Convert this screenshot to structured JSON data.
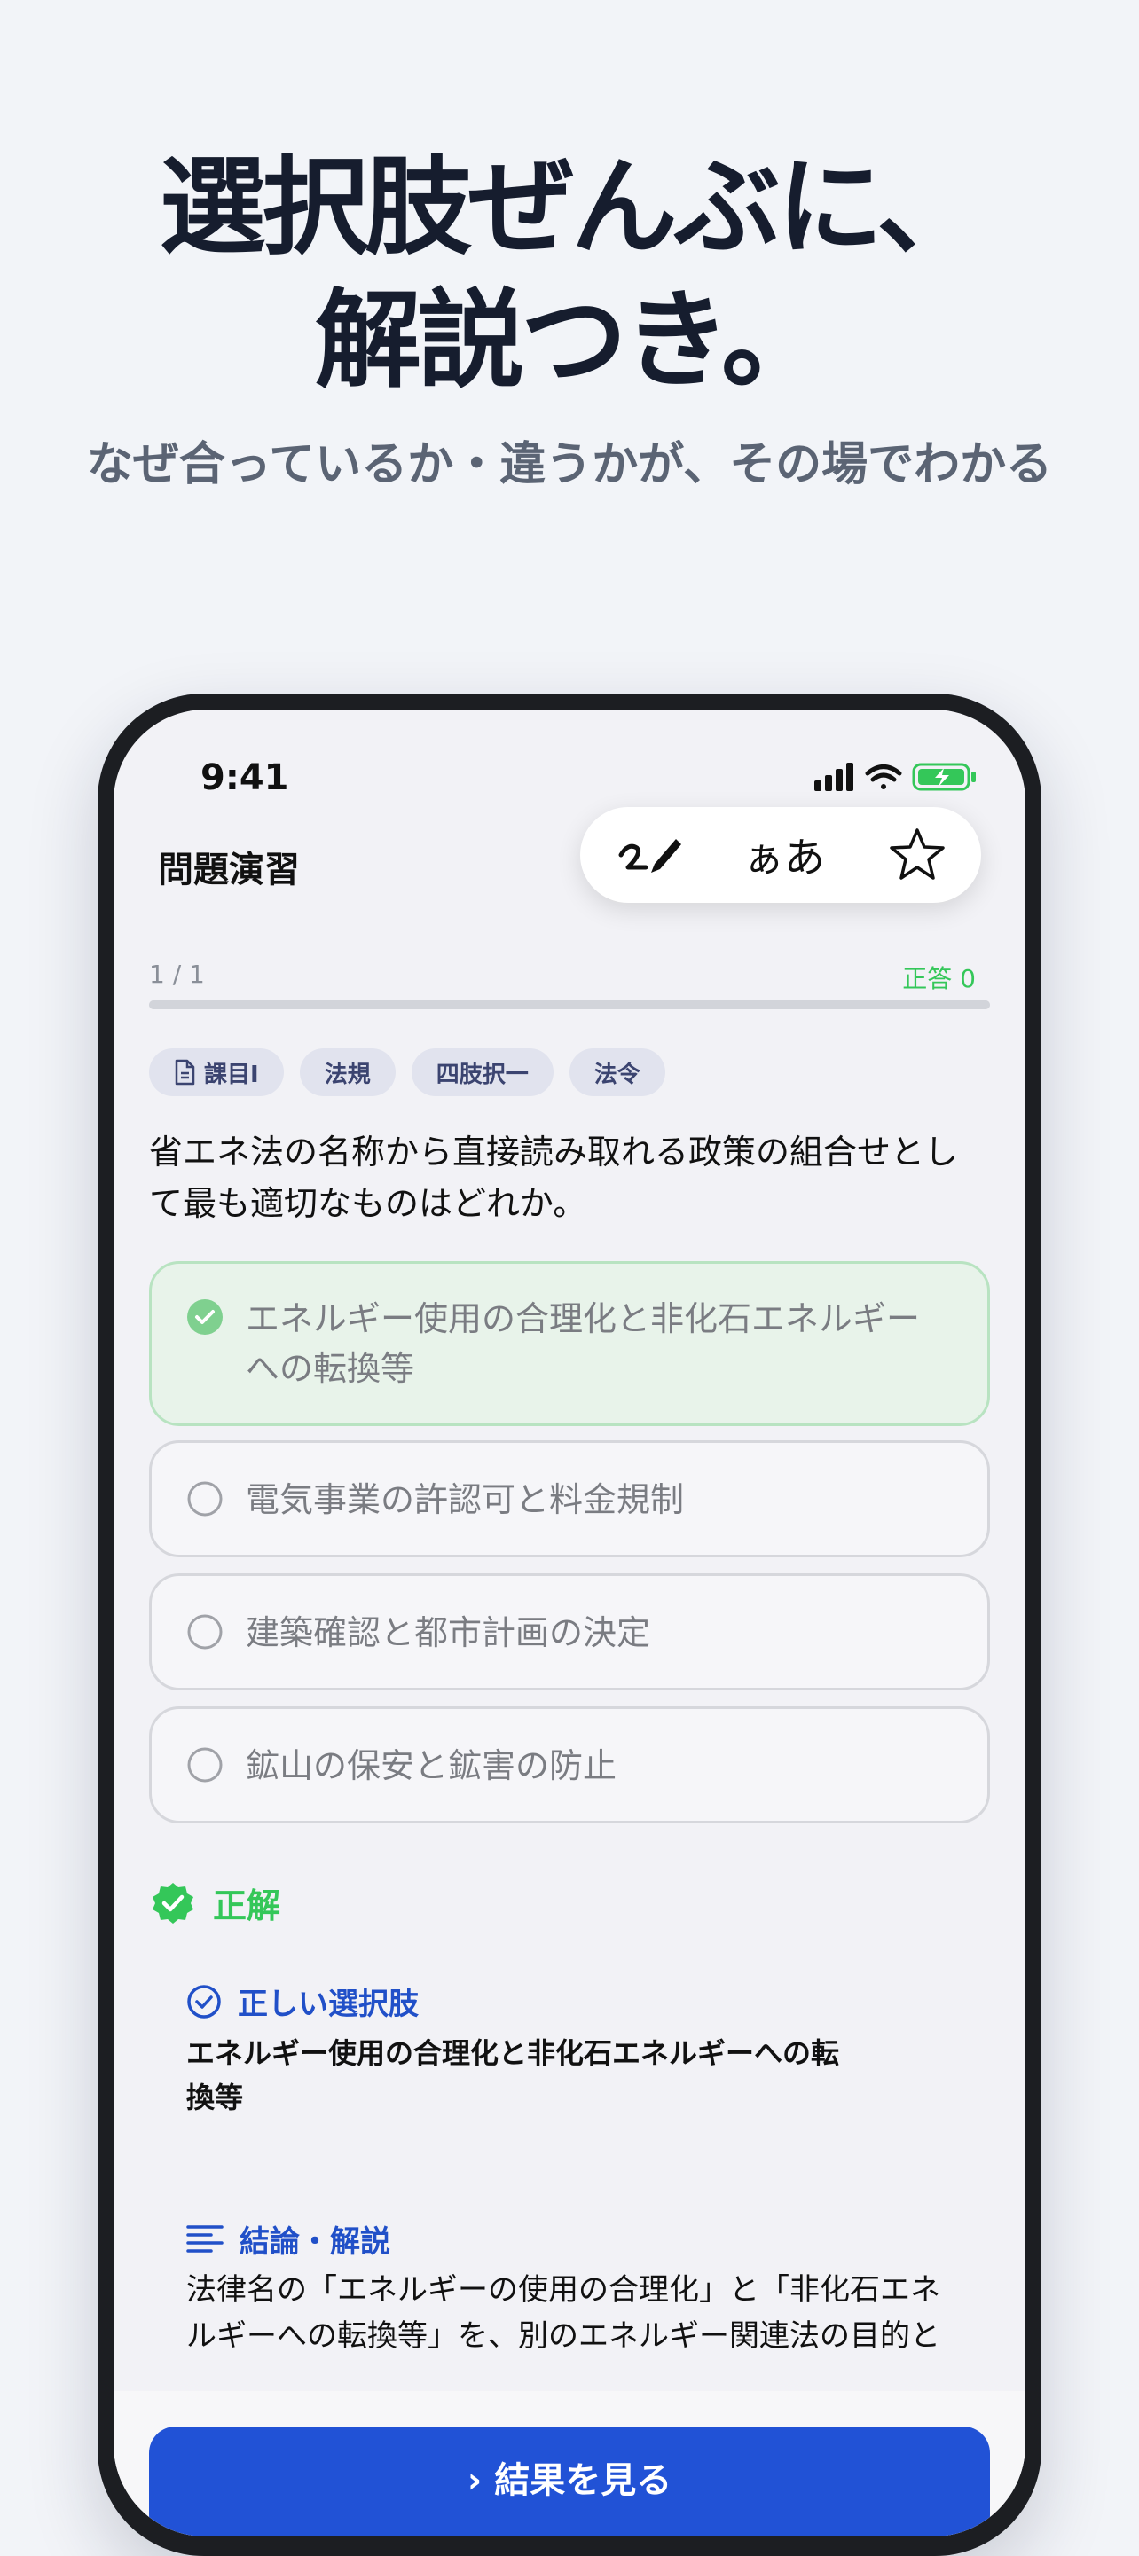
{
  "hero": {
    "title_line1": "選択肢ぜんぶに、",
    "title_line2": "解説つき。",
    "subtitle": "なぜ合っているか・違うかが、その場でわかる"
  },
  "status_bar": {
    "time": "9:41"
  },
  "nav": {
    "title": "問題演習",
    "font_size_label": "ぁあ"
  },
  "progress": {
    "label": "1 / 1",
    "correct": "正答 0",
    "fraction": 1.0
  },
  "tags": [
    "課目Ⅰ",
    "法規",
    "四肢択一",
    "法令"
  ],
  "question": "省エネ法の名称から直接読み取れる政策の組合せとして最も適切なものはどれか。",
  "choices": [
    {
      "text": "エネルギー使用の合理化と非化石エネルギーへの転換等",
      "state": "correct"
    },
    {
      "text": "電気事業の許認可と料金規制",
      "state": "default"
    },
    {
      "text": "建築確認と都市計画の決定",
      "state": "default"
    },
    {
      "text": "鉱山の保安と鉱害の防止",
      "state": "default"
    }
  ],
  "result": {
    "label": "正解"
  },
  "explanation": {
    "correct_choice_heading": "正しい選択肢",
    "correct_choice_text": "エネルギー使用の合理化と非化石エネルギーへの転換等",
    "conclusion_heading": "結論・解説",
    "conclusion_text": "法律名の「エネルギーの使用の合理化」と「非化石エネルギーへの転換等」を、別のエネルギー関連法の目的と"
  },
  "primary_button": {
    "label": "› 結果を見る"
  },
  "colors": {
    "accent": "#2152d6",
    "success": "#34c759",
    "correct_bg": "#e8f3ea",
    "tag_bg": "#e1e3ee"
  }
}
